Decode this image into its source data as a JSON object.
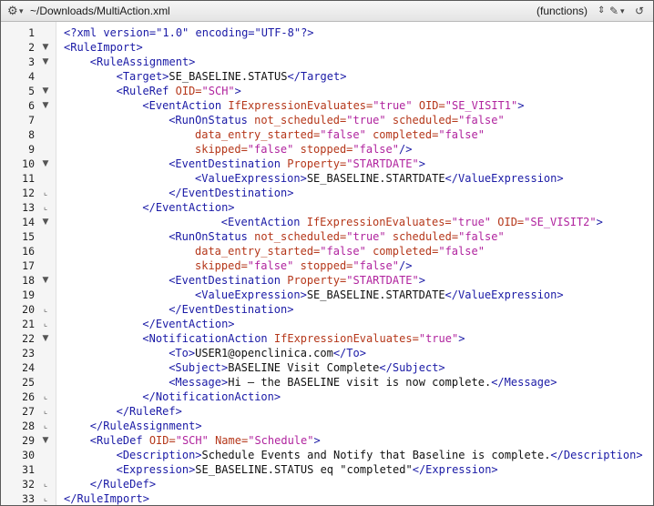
{
  "window": {
    "path": "~/Downloads/MultiAction.xml",
    "symbol_menu": "(functions)",
    "gear_icon": "gear-icon",
    "updown_icon": "updown-icon",
    "pin_icon": "pin-icon",
    "history_icon": "history-icon"
  },
  "colors": {
    "tag": "#1a1aa6",
    "attribute": "#b5371a",
    "string": "#b0239e",
    "text": "#111111"
  },
  "editor": {
    "lines": [
      {
        "n": "1",
        "fold": "",
        "tokens": [
          {
            "t": "pi",
            "s": "<?xml version=\"1.0\" encoding=\"UTF-8\"?>"
          }
        ]
      },
      {
        "n": "2",
        "fold": "open",
        "tokens": [
          {
            "t": "tag",
            "s": "<RuleImport>"
          }
        ]
      },
      {
        "n": "3",
        "fold": "open",
        "tokens": [
          {
            "t": "tag",
            "s": "<RuleAssignment>"
          }
        ]
      },
      {
        "n": "4",
        "fold": "",
        "tokens": [
          {
            "t": "tag",
            "s": "<Target>"
          },
          {
            "t": "text",
            "s": "SE_BASELINE.STATUS"
          },
          {
            "t": "tag",
            "s": "</Target>"
          }
        ]
      },
      {
        "n": "5",
        "fold": "open",
        "tokens": [
          {
            "t": "tag",
            "s": "<RuleRef "
          },
          {
            "t": "attr",
            "s": "OID="
          },
          {
            "t": "str",
            "s": "\"SCH\""
          },
          {
            "t": "tag",
            "s": ">"
          }
        ]
      },
      {
        "n": "6",
        "fold": "open",
        "tokens": [
          {
            "t": "tag",
            "s": "<EventAction "
          },
          {
            "t": "attr",
            "s": "IfExpressionEvaluates="
          },
          {
            "t": "str",
            "s": "\"true\""
          },
          {
            "t": "attr",
            "s": " OID="
          },
          {
            "t": "str",
            "s": "\"SE_VISIT1\""
          },
          {
            "t": "tag",
            "s": ">"
          }
        ]
      },
      {
        "n": "7",
        "fold": "",
        "tokens": [
          {
            "t": "tag",
            "s": "<RunOnStatus "
          },
          {
            "t": "attr",
            "s": "not_scheduled="
          },
          {
            "t": "str",
            "s": "\"true\""
          },
          {
            "t": "attr",
            "s": " scheduled="
          },
          {
            "t": "str",
            "s": "\"false\""
          }
        ]
      },
      {
        "n": "8",
        "fold": "",
        "tokens": [
          {
            "t": "attr",
            "s": "data_entry_started="
          },
          {
            "t": "str",
            "s": "\"false\""
          },
          {
            "t": "attr",
            "s": " completed="
          },
          {
            "t": "str",
            "s": "\"false\""
          }
        ]
      },
      {
        "n": "9",
        "fold": "",
        "tokens": [
          {
            "t": "attr",
            "s": "skipped="
          },
          {
            "t": "str",
            "s": "\"false\""
          },
          {
            "t": "attr",
            "s": " stopped="
          },
          {
            "t": "str",
            "s": "\"false\""
          },
          {
            "t": "tag",
            "s": "/>"
          }
        ]
      },
      {
        "n": "10",
        "fold": "open",
        "tokens": [
          {
            "t": "tag",
            "s": "<EventDestination "
          },
          {
            "t": "attr",
            "s": "Property="
          },
          {
            "t": "str",
            "s": "\"STARTDATE\""
          },
          {
            "t": "tag",
            "s": ">"
          }
        ]
      },
      {
        "n": "11",
        "fold": "",
        "tokens": [
          {
            "t": "tag",
            "s": "<ValueExpression>"
          },
          {
            "t": "text",
            "s": "SE_BASELINE.STARTDATE"
          },
          {
            "t": "tag",
            "s": "</ValueExpression>"
          }
        ]
      },
      {
        "n": "12",
        "fold": "end",
        "tokens": [
          {
            "t": "tag",
            "s": "</EventDestination>"
          }
        ]
      },
      {
        "n": "13",
        "fold": "end",
        "tokens": [
          {
            "t": "tag",
            "s": "</EventAction>"
          }
        ]
      },
      {
        "n": "14",
        "fold": "open",
        "tokens": [
          {
            "t": "tag",
            "s": "<EventAction "
          },
          {
            "t": "attr",
            "s": "IfExpressionEvaluates="
          },
          {
            "t": "str",
            "s": "\"true\""
          },
          {
            "t": "attr",
            "s": " OID="
          },
          {
            "t": "str",
            "s": "\"SE_VISIT2\""
          },
          {
            "t": "tag",
            "s": ">"
          }
        ]
      },
      {
        "n": "15",
        "fold": "",
        "tokens": [
          {
            "t": "tag",
            "s": "<RunOnStatus "
          },
          {
            "t": "attr",
            "s": "not_scheduled="
          },
          {
            "t": "str",
            "s": "\"true\""
          },
          {
            "t": "attr",
            "s": " scheduled="
          },
          {
            "t": "str",
            "s": "\"false\""
          }
        ]
      },
      {
        "n": "16",
        "fold": "",
        "tokens": [
          {
            "t": "attr",
            "s": "data_entry_started="
          },
          {
            "t": "str",
            "s": "\"false\""
          },
          {
            "t": "attr",
            "s": " completed="
          },
          {
            "t": "str",
            "s": "\"false\""
          }
        ]
      },
      {
        "n": "17",
        "fold": "",
        "tokens": [
          {
            "t": "attr",
            "s": "skipped="
          },
          {
            "t": "str",
            "s": "\"false\""
          },
          {
            "t": "attr",
            "s": " stopped="
          },
          {
            "t": "str",
            "s": "\"false\""
          },
          {
            "t": "tag",
            "s": "/>"
          }
        ]
      },
      {
        "n": "18",
        "fold": "open",
        "tokens": [
          {
            "t": "tag",
            "s": "<EventDestination "
          },
          {
            "t": "attr",
            "s": "Property="
          },
          {
            "t": "str",
            "s": "\"STARTDATE\""
          },
          {
            "t": "tag",
            "s": ">"
          }
        ]
      },
      {
        "n": "19",
        "fold": "",
        "tokens": [
          {
            "t": "tag",
            "s": "<ValueExpression>"
          },
          {
            "t": "text",
            "s": "SE_BASELINE.STARTDATE"
          },
          {
            "t": "tag",
            "s": "</ValueExpression>"
          }
        ]
      },
      {
        "n": "20",
        "fold": "end",
        "tokens": [
          {
            "t": "tag",
            "s": "</EventDestination>"
          }
        ]
      },
      {
        "n": "21",
        "fold": "end",
        "tokens": [
          {
            "t": "tag",
            "s": "</EventAction>"
          }
        ]
      },
      {
        "n": "22",
        "fold": "open",
        "tokens": [
          {
            "t": "tag",
            "s": "<NotificationAction "
          },
          {
            "t": "attr",
            "s": "IfExpressionEvaluates="
          },
          {
            "t": "str",
            "s": "\"true\""
          },
          {
            "t": "tag",
            "s": ">"
          }
        ]
      },
      {
        "n": "23",
        "fold": "",
        "tokens": [
          {
            "t": "tag",
            "s": "<To>"
          },
          {
            "t": "text",
            "s": "USER1@openclinica.com"
          },
          {
            "t": "tag",
            "s": "</To>"
          }
        ]
      },
      {
        "n": "24",
        "fold": "",
        "tokens": [
          {
            "t": "tag",
            "s": "<Subject>"
          },
          {
            "t": "text",
            "s": "BASELINE Visit Complete"
          },
          {
            "t": "tag",
            "s": "</Subject>"
          }
        ]
      },
      {
        "n": "25",
        "fold": "",
        "tokens": [
          {
            "t": "tag",
            "s": "<Message>"
          },
          {
            "t": "text",
            "s": "Hi – the BASELINE visit is now complete."
          },
          {
            "t": "tag",
            "s": "</Message>"
          }
        ]
      },
      {
        "n": "26",
        "fold": "end",
        "tokens": [
          {
            "t": "tag",
            "s": "</NotificationAction>"
          }
        ]
      },
      {
        "n": "27",
        "fold": "end",
        "tokens": [
          {
            "t": "tag",
            "s": "</RuleRef>"
          }
        ]
      },
      {
        "n": "28",
        "fold": "end",
        "tokens": [
          {
            "t": "tag",
            "s": "</RuleAssignment>"
          }
        ]
      },
      {
        "n": "29",
        "fold": "open",
        "tokens": [
          {
            "t": "tag",
            "s": "<RuleDef "
          },
          {
            "t": "attr",
            "s": "OID="
          },
          {
            "t": "str",
            "s": "\"SCH\""
          },
          {
            "t": "attr",
            "s": " Name="
          },
          {
            "t": "str",
            "s": "\"Schedule\""
          },
          {
            "t": "tag",
            "s": ">"
          }
        ]
      },
      {
        "n": "30",
        "fold": "",
        "tokens": [
          {
            "t": "tag",
            "s": "<Description>"
          },
          {
            "t": "text",
            "s": "Schedule Events and Notify that Baseline is complete."
          },
          {
            "t": "tag",
            "s": "</Description>"
          }
        ]
      },
      {
        "n": "31",
        "fold": "",
        "tokens": [
          {
            "t": "tag",
            "s": "<Expression>"
          },
          {
            "t": "text",
            "s": "SE_BASELINE.STATUS eq \"completed\""
          },
          {
            "t": "tag",
            "s": "</Expression>"
          }
        ]
      },
      {
        "n": "32",
        "fold": "end",
        "tokens": [
          {
            "t": "tag",
            "s": "</RuleDef>"
          }
        ]
      },
      {
        "n": "33",
        "fold": "end",
        "tokens": [
          {
            "t": "tag",
            "s": "</RuleImport>"
          }
        ]
      }
    ]
  }
}
